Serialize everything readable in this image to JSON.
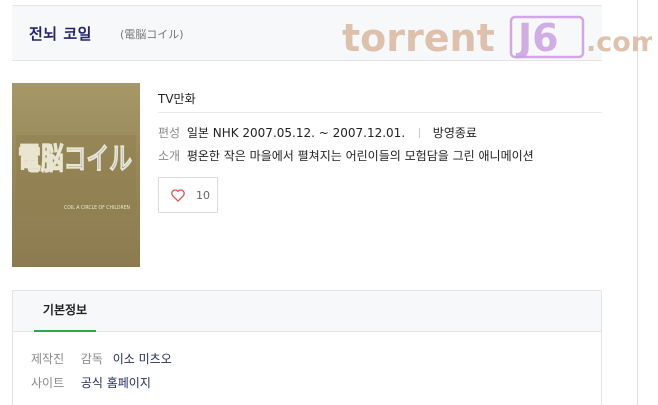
{
  "title": {
    "main": "전뇌 코일",
    "sub": "(電脳コイル)"
  },
  "watermark": {
    "text_left": "torrent",
    "text_box": "J6",
    "text_right": ".com",
    "color": "#d8b79f"
  },
  "poster": {
    "logo_text": "電脳コイル",
    "tagline": "COIL A CIRCLE OF CHILDREN"
  },
  "details": {
    "genre": "TV만화",
    "broadcast_label": "편성",
    "broadcast_value": "일본 NHK 2007.05.12. ~ 2007.12.01.",
    "status": "방영종료",
    "summary_label": "소개",
    "summary_value": "평온한 작은 마을에서 펼쳐지는 어린이들의 모험담을 그린 애니메이션"
  },
  "like": {
    "icon": "heart-outline-icon",
    "count": "10",
    "color": "#e0514e"
  },
  "basic_info": {
    "tab_label": "기본정보",
    "accent": "#2aa84a",
    "rows": [
      {
        "label": "제작진",
        "sub": "감독",
        "value": "이소 미츠오"
      },
      {
        "label": "사이트",
        "sub": "",
        "value": "공식 홈페이지"
      }
    ]
  }
}
